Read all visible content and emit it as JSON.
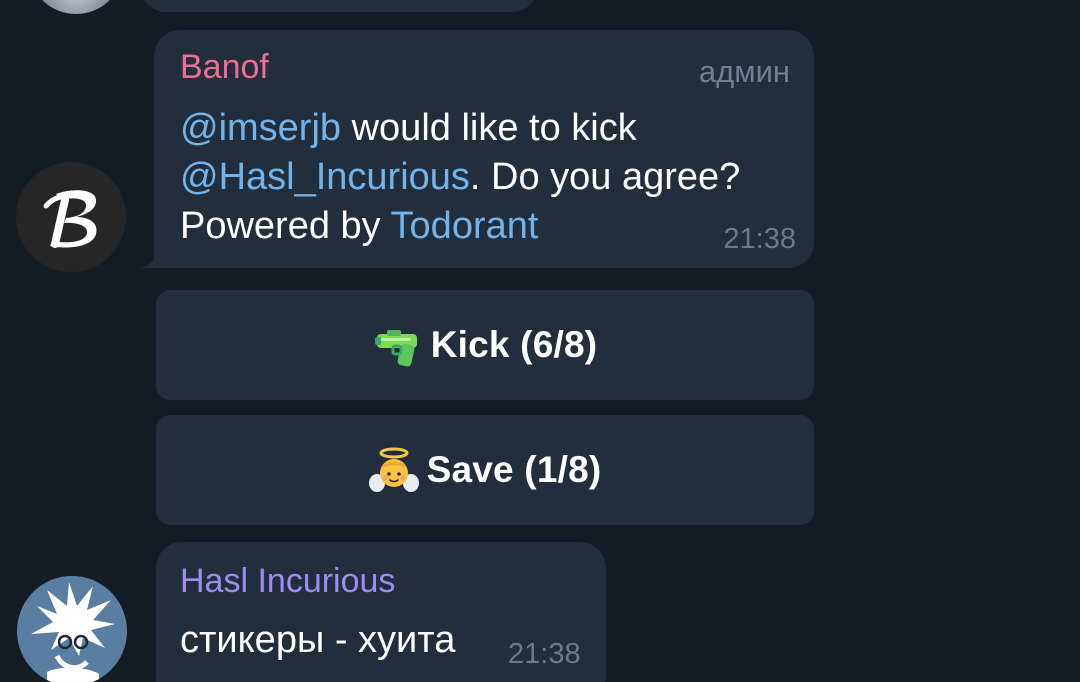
{
  "messages": [
    {
      "sender": "Banof",
      "role_badge": "админ",
      "text_parts": {
        "mention_1": "@imserjb",
        "text_1": " would like to kick",
        "mention_2": "@Hasl_Incurious",
        "text_2": ". Do you agree?",
        "text_3": "Powered by ",
        "link": "Todorant"
      },
      "time": "21:38",
      "avatar_icon": "b-letter-logo",
      "sender_color": "#ee6e93"
    },
    {
      "sender": "Hasl Incurious",
      "text": "стикеры - хуита",
      "time": "21:38",
      "avatar_icon": "spiky-hair-character",
      "sender_color": "#9e8cf5"
    }
  ],
  "inline_keyboard": [
    {
      "label": "Kick (6/8)",
      "icon": "water-pistol-icon"
    },
    {
      "label": "Save (1/8)",
      "icon": "angel-baby-icon"
    }
  ],
  "colors": {
    "background": "#141c26",
    "bubble": "#222e3b",
    "link": "#71b3ea",
    "meta": "#6c7a88"
  }
}
